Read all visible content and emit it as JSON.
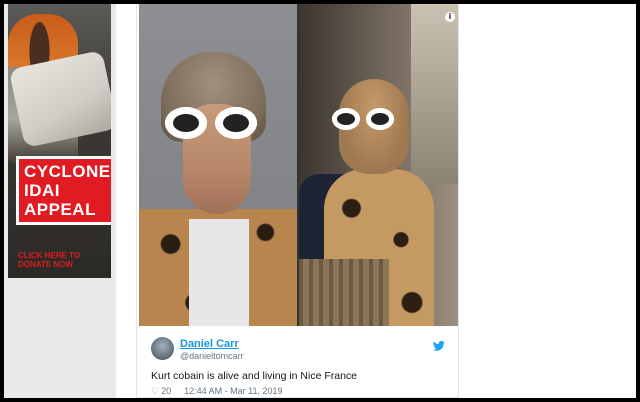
{
  "ad": {
    "title_lines": [
      "CYCLONE",
      "IDAI",
      "APPEAL"
    ],
    "cta_lines": [
      "CLICK HERE TO",
      "DONATE NOW"
    ],
    "brand_color": "#e11b22"
  },
  "tweet": {
    "author_name": "Daniel Carr",
    "author_handle": "@danieltomcarr",
    "text": "Kurt cobain is alive and living in Nice France",
    "likes": "20",
    "time": "12:44 AM - Mar 11, 2019",
    "info_icon": "info-icon",
    "bird_icon": "twitter-bird-icon",
    "heart_icon": "heart-icon",
    "link_color": "#1b95e0"
  }
}
